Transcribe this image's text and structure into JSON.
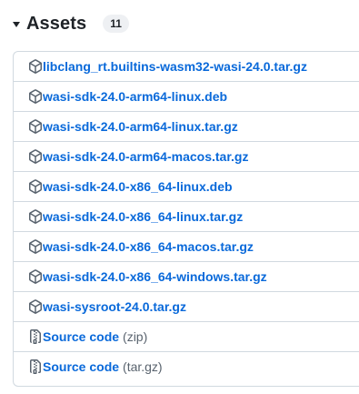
{
  "assets": {
    "title": "Assets",
    "count": "11",
    "items": [
      {
        "name": "libclang_rt.builtins-wasm32-wasi-24.0.tar.gz",
        "icon": "package-icon"
      },
      {
        "name": "wasi-sdk-24.0-arm64-linux.deb",
        "icon": "package-icon"
      },
      {
        "name": "wasi-sdk-24.0-arm64-linux.tar.gz",
        "icon": "package-icon"
      },
      {
        "name": "wasi-sdk-24.0-arm64-macos.tar.gz",
        "icon": "package-icon"
      },
      {
        "name": "wasi-sdk-24.0-x86_64-linux.deb",
        "icon": "package-icon"
      },
      {
        "name": "wasi-sdk-24.0-x86_64-linux.tar.gz",
        "icon": "package-icon"
      },
      {
        "name": "wasi-sdk-24.0-x86_64-macos.tar.gz",
        "icon": "package-icon"
      },
      {
        "name": "wasi-sdk-24.0-x86_64-windows.tar.gz",
        "icon": "package-icon"
      },
      {
        "name": "wasi-sysroot-24.0.tar.gz",
        "icon": "package-icon"
      },
      {
        "name": "Source code",
        "suffix": "(zip)",
        "icon": "file-zip-icon"
      },
      {
        "name": "Source code",
        "suffix": "(tar.gz)",
        "icon": "file-zip-icon"
      }
    ]
  },
  "colors": {
    "link": "#0969da",
    "muted": "#59636e",
    "border": "#d1d9e0",
    "counter_bg": "#eef0f3"
  }
}
